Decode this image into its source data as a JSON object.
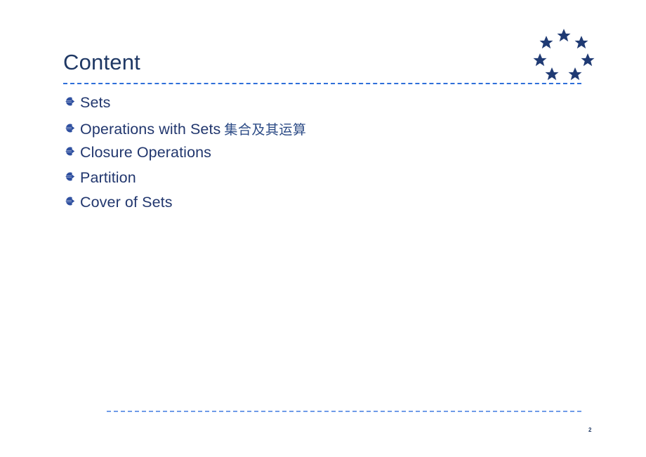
{
  "slide": {
    "title": "Content",
    "page_number": "2",
    "background_color": "#ffffff",
    "title_color": "#1F3864",
    "accent_color": "#2E6FD9",
    "bullet_text_color": "#22376E"
  },
  "logo": {
    "name": "eu-stars-circle-logo",
    "star_count": 7,
    "color": "#1F3A73"
  },
  "dividers": {
    "top_rule_color": "#2E6FD9",
    "bottom_rule_color": "#6F9BE8"
  },
  "bullets": {
    "marker_icon": "arrow-bullet-icon",
    "marker_color": "#2F50A0",
    "items": [
      {
        "text": "Sets",
        "cn": ""
      },
      {
        "text": "Operations with Sets",
        "cn": "集合及其运算"
      },
      {
        "text": "Closure Operations",
        "cn": ""
      },
      {
        "text": "Partition",
        "cn": ""
      },
      {
        "text": "Cover of Sets",
        "cn": ""
      }
    ]
  }
}
